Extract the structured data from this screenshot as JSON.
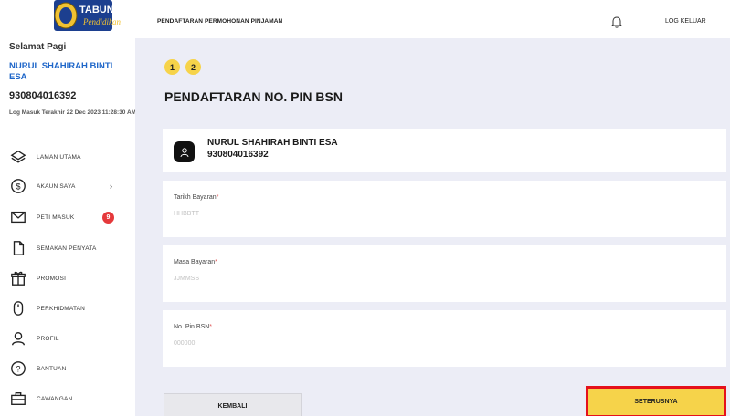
{
  "sidebar": {
    "greeting": "Selamat Pagi",
    "user_name": "NURUL SHAHIRAH BINTI ESA",
    "user_ic": "930804016392",
    "last_login": "Log Masuk Terakhir 22 Dec 2023 11:28:30 AM",
    "items": [
      {
        "label": "LAMAN UTAMA",
        "icon": "layers-icon"
      },
      {
        "label": "AKAUN SAYA",
        "icon": "dollar-circle-icon",
        "chevron": "›"
      },
      {
        "label": "PETI MASUK",
        "icon": "mail-icon",
        "badge": "9"
      },
      {
        "label": "SEMAKAN PENYATA",
        "icon": "document-icon"
      },
      {
        "label": "PROMOSI",
        "icon": "gift-icon"
      },
      {
        "label": "PERKHIDMATAN",
        "icon": "mouse-icon"
      },
      {
        "label": "PROFIL",
        "icon": "user-icon"
      },
      {
        "label": "BANTUAN",
        "icon": "help-icon"
      },
      {
        "label": "CAWANGAN",
        "icon": "briefcase-icon"
      }
    ]
  },
  "header": {
    "title": "PENDAFTARAN PERMOHONAN PINJAMAN",
    "logout": "LOG KELUAR"
  },
  "main": {
    "steps": [
      "1",
      "2"
    ],
    "page_title": "PENDAFTARAN NO. PIN BSN",
    "profile": {
      "name": "NURUL SHAHIRAH BINTI ESA",
      "ic": "930804016392"
    },
    "fields": [
      {
        "label": "Tarikh Bayaran",
        "required": "*",
        "placeholder": "HHBBTT"
      },
      {
        "label": "Masa Bayaran",
        "required": "*",
        "placeholder": "JJMMSS"
      },
      {
        "label": "No. Pin BSN",
        "required": "*",
        "placeholder": "000000"
      }
    ],
    "back_label": "KEMBALI",
    "next_label": "SETERUSNYA"
  },
  "colors": {
    "accent_yellow": "#f6d34a",
    "highlight_red": "#e5111b",
    "link_blue": "#1e66c9",
    "badge_red": "#e5393b",
    "background": "#ecedf6"
  }
}
